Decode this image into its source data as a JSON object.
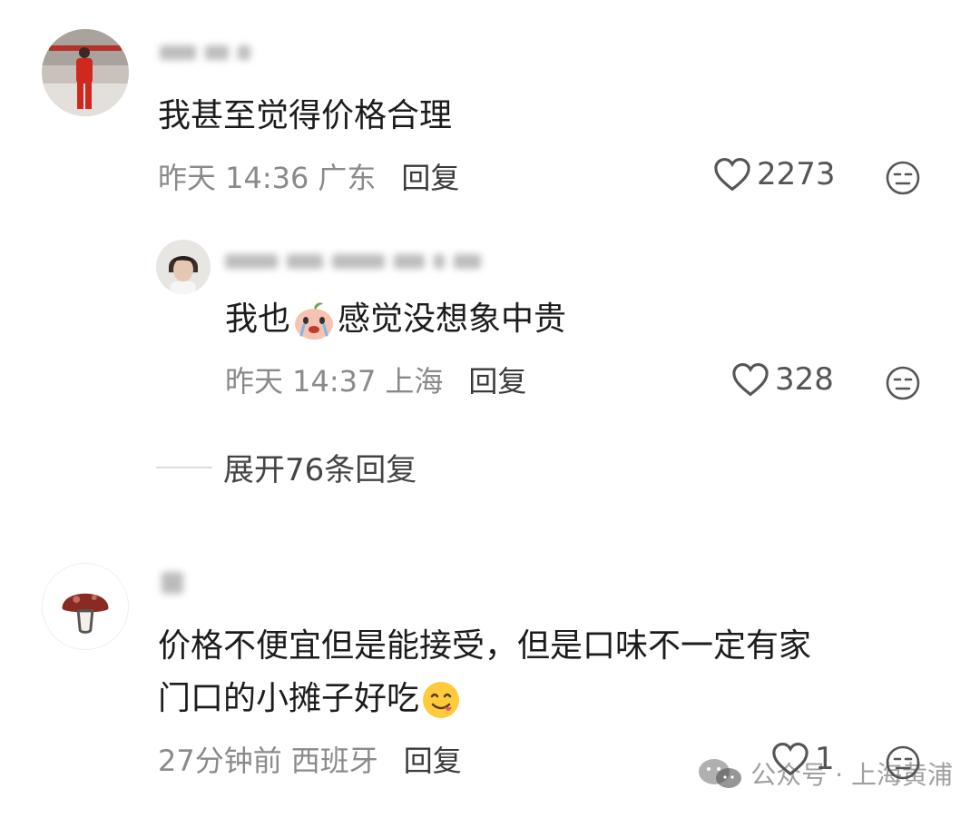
{
  "comments": [
    {
      "text": "我甚至觉得价格合理",
      "time": "昨天 14:36",
      "location": "广东",
      "reply_label": "回复",
      "likes": "2273"
    },
    {
      "text_before": "我也",
      "text_after": "感觉没想象中贵",
      "time": "昨天 14:37",
      "location": "上海",
      "reply_label": "回复",
      "likes": "328"
    }
  ],
  "expand_label": "展开76条回复",
  "comment3": {
    "line1": "价格不便宜但是能接受，但是口味不一定有家",
    "line2": "门口的小摊子好吃",
    "time": "27分钟前",
    "location": "西班牙",
    "reply_label": "回复",
    "likes": "1"
  },
  "watermark": "公众号 · 上海黄浦",
  "colors": {
    "accent_red": "#d9322b",
    "meta_gray": "#8a8a8a",
    "text": "#1c1c1c"
  }
}
